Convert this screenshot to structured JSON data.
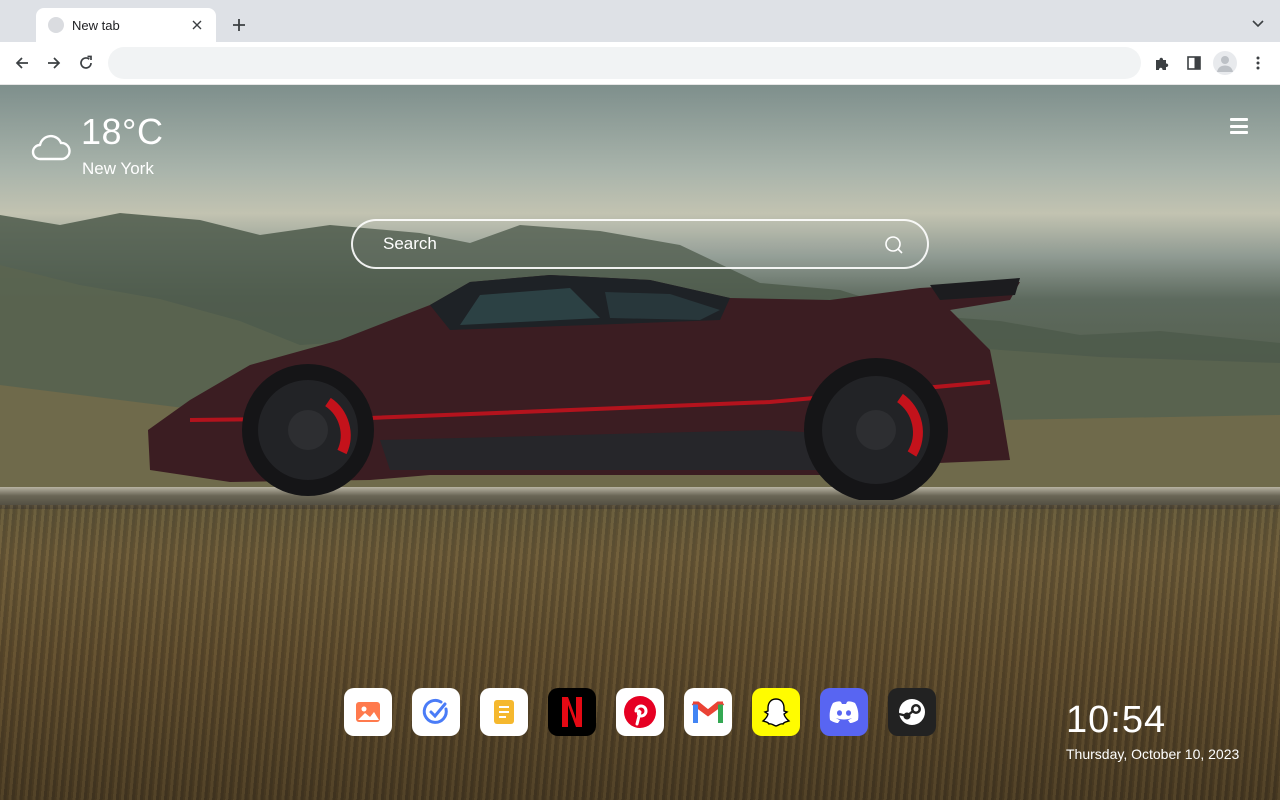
{
  "browser": {
    "tab": {
      "title": "New tab"
    },
    "omnibox": {
      "value": "",
      "placeholder": ""
    }
  },
  "weather": {
    "temperature": "18°C",
    "city": "New York",
    "icon": "cloud-icon"
  },
  "search": {
    "placeholder": "Search"
  },
  "apps": [
    {
      "name": "Photos",
      "icon": "photos-icon",
      "bg": "#ffffff"
    },
    {
      "name": "Tasks",
      "icon": "check-icon",
      "bg": "#ffffff"
    },
    {
      "name": "Notes",
      "icon": "notes-icon",
      "bg": "#ffffff"
    },
    {
      "name": "Netflix",
      "icon": "netflix-icon",
      "bg": "#000000"
    },
    {
      "name": "Pinterest",
      "icon": "pinterest-icon",
      "bg": "#ffffff"
    },
    {
      "name": "Gmail",
      "icon": "gmail-icon",
      "bg": "#ffffff"
    },
    {
      "name": "Snapchat",
      "icon": "snapchat-icon",
      "bg": "#fffc00"
    },
    {
      "name": "Discord",
      "icon": "discord-icon",
      "bg": "#5865f2"
    },
    {
      "name": "Steam",
      "icon": "steam-icon",
      "bg": "#222222"
    }
  ],
  "clock": {
    "time": "10:54",
    "date": "Thursday, October 10, 2023"
  }
}
